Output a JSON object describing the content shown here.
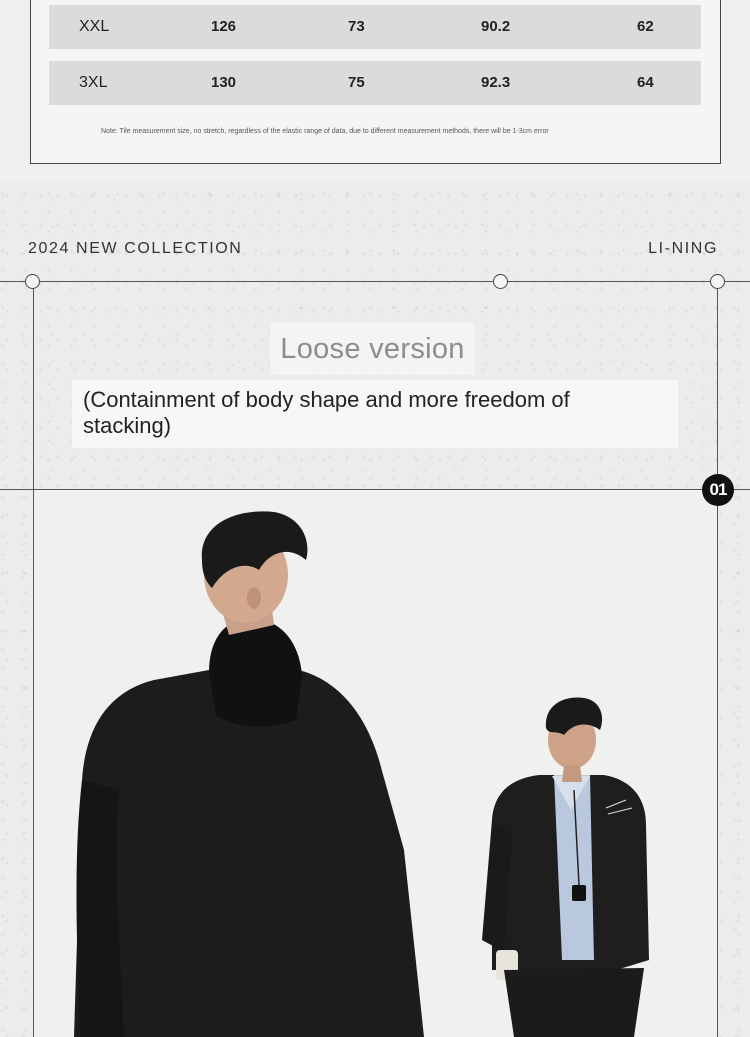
{
  "size_table": {
    "rows": [
      {
        "size": "XXL",
        "v1": "126",
        "v2": "73",
        "v3": "90.2",
        "v4": "62"
      },
      {
        "size": "3XL",
        "v1": "130",
        "v2": "75",
        "v3": "92.3",
        "v4": "64"
      }
    ],
    "note": "Note: Tile measurement size, no stretch, regardless of the elastic range of data, due to different measurement methods, there will be 1-3cm error"
  },
  "header": {
    "collection": "2024 NEW COLLECTION",
    "brand": "LI-NING"
  },
  "fit": {
    "title": "Loose version",
    "description": "(Containment of body shape and more freedom of stacking)",
    "badge": "01"
  },
  "colors": {
    "frame_line": "#555555",
    "hoodie": "#1c1c1c",
    "badge": "#111111"
  }
}
